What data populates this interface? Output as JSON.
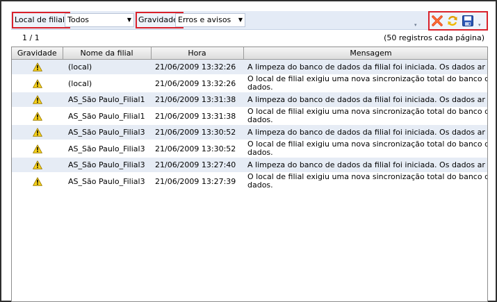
{
  "toolbar": {
    "branch_filter_label": "Local de filial:",
    "branch_filter_value": "Todos",
    "severity_filter_label": "Gravidade:",
    "severity_filter_value": "Erros e avisos",
    "actions": [
      "delete-icon",
      "refresh-icon",
      "save-icon"
    ]
  },
  "pager": {
    "page": "1 / 1",
    "records_info": "(50 registros cada página)"
  },
  "grid": {
    "columns": [
      "Gravidade",
      "Nome da filial",
      "Hora",
      "Mensagem"
    ],
    "rows": [
      {
        "severity": "warning-icon",
        "branch": "(local)",
        "time": "21/06/2009 13:32:26",
        "message": "A limpeza do banco de dados da filial foi iniciada. Os dados ar"
      },
      {
        "severity": "warning-icon",
        "branch": "(local)",
        "time": "21/06/2009 13:32:26",
        "message": "O local de filial exigiu uma nova sincronização total do banco de dados."
      },
      {
        "severity": "warning-icon",
        "branch": "AS_São Paulo_Filial1",
        "time": "21/06/2009 13:31:38",
        "message": "A limpeza do banco de dados da filial foi iniciada. Os dados ar"
      },
      {
        "severity": "warning-icon",
        "branch": "AS_São Paulo_Filial1",
        "time": "21/06/2009 13:31:38",
        "message": "O local de filial exigiu uma nova sincronização total do banco de dados."
      },
      {
        "severity": "warning-icon",
        "branch": "AS_São Paulo_Filial3",
        "time": "21/06/2009 13:30:52",
        "message": "A limpeza do banco de dados da filial foi iniciada. Os dados ar"
      },
      {
        "severity": "warning-icon",
        "branch": "AS_São Paulo_Filial3",
        "time": "21/06/2009 13:30:52",
        "message": "O local de filial exigiu uma nova sincronização total do banco de dados."
      },
      {
        "severity": "warning-icon",
        "branch": "AS_São Paulo_Filial3",
        "time": "21/06/2009 13:27:40",
        "message": "A limpeza do banco de dados da filial foi iniciada. Os dados ar"
      },
      {
        "severity": "warning-icon",
        "branch": "AS_São Paulo_Filial3",
        "time": "21/06/2009 13:27:39",
        "message": "O local de filial exigiu uma nova sincronização total do banco de dados."
      }
    ]
  }
}
